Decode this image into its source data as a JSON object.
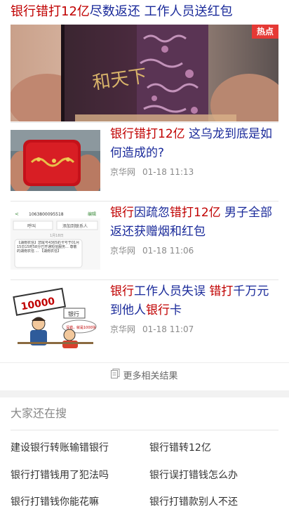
{
  "top_card": {
    "title_red": "银行错打12亿",
    "title_rest": "尽数返还 工作人员送红包",
    "badge": "热点",
    "image_text": "和天下"
  },
  "news": [
    {
      "title_parts": [
        {
          "text": "银行错打12亿",
          "hl": true
        },
        {
          "text": " 这乌龙到底是如何造成的?",
          "hl": false
        }
      ],
      "source": "京华网",
      "time": "01-18 11:13"
    },
    {
      "title_parts": [
        {
          "text": "银行",
          "hl": true
        },
        {
          "text": "因疏忽",
          "hl": false
        },
        {
          "text": "错打12亿",
          "hl": true
        },
        {
          "text": " 男子全部返还获赠烟和红包",
          "hl": false
        }
      ],
      "source": "京华网",
      "time": "01-18 11:06"
    },
    {
      "title_parts": [
        {
          "text": "银行",
          "hl": true
        },
        {
          "text": "工作人员失误 ",
          "hl": false
        },
        {
          "text": "错打",
          "hl": true
        },
        {
          "text": "千万元到他人",
          "hl": false
        },
        {
          "text": "银行",
          "hl": true
        },
        {
          "text": "卡",
          "hl": false
        }
      ],
      "source": "京华网",
      "time": "01-18 11:07"
    }
  ],
  "thumbs": {
    "sms_header": "1063800095518",
    "sms_action": "编辑",
    "sms_btn1": "呼叫",
    "sms_btn2": "添加到联系人",
    "sms_date": "1月18日",
    "sms_body": "【湖南农信】您尾号4365的卡号于01月15日15时58分已开通短信服务... 尊敬的湖南农信 ... 【湖南农信】",
    "cartoon_number": "10000",
    "cartoon_label": "银行",
    "cartoon_bubble": "没错，就是1000块"
  },
  "more_results": "更多相关结果",
  "related": {
    "title": "大家还在搜",
    "items": [
      "建设银行转账输错银行",
      "银行错转12亿",
      "银行打错钱用了犯法吗",
      "银行误打错钱怎么办",
      "银行打错钱你能花嘛",
      "银行打错款别人不还"
    ]
  }
}
